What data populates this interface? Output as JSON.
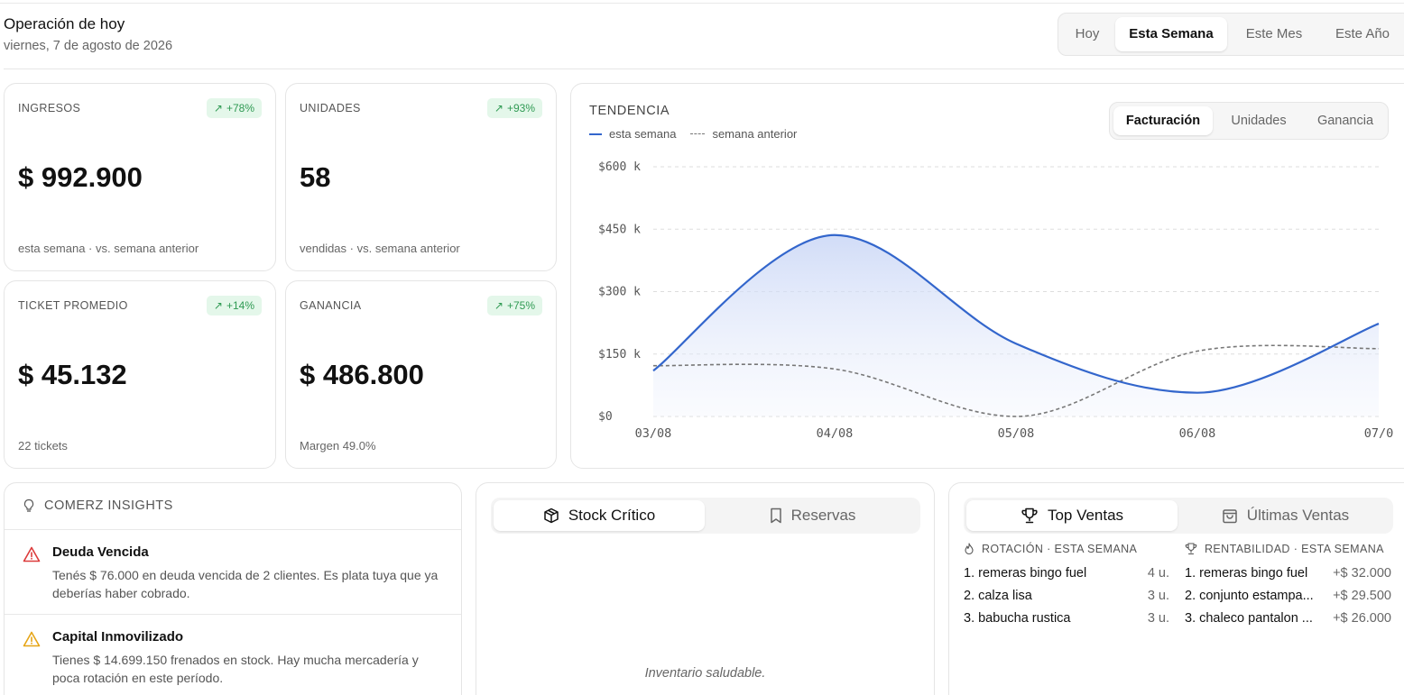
{
  "header": {
    "title": "Operación de hoy",
    "date": "viernes, 7 de agosto de 2026",
    "periods": [
      "Hoy",
      "Esta Semana",
      "Este Mes",
      "Este Año"
    ],
    "active_period": "Esta Semana"
  },
  "kpis": {
    "ingresos": {
      "label": "INGRESOS",
      "badge": "+78%",
      "value": "$ 992.900",
      "sub": "esta semana · vs. semana anterior"
    },
    "unidades": {
      "label": "UNIDADES",
      "badge": "+93%",
      "value": "58",
      "sub": "vendidas · vs. semana anterior"
    },
    "ticket": {
      "label": "TICKET PROMEDIO",
      "badge": "+14%",
      "value": "$ 45.132",
      "sub": "22 tickets"
    },
    "ganancia": {
      "label": "GANANCIA",
      "badge": "+75%",
      "value": "$ 486.800",
      "sub": "Margen 49.0%"
    }
  },
  "trend": {
    "title": "TENDENCIA",
    "legend_current": "esta semana",
    "legend_previous": "semana anterior",
    "tabs": [
      "Facturación",
      "Unidades",
      "Ganancia"
    ],
    "active_tab": "Facturación",
    "colors": {
      "current": "#3366cc",
      "previous": "#777777",
      "fill": "#dfe7fb"
    }
  },
  "chart_data": {
    "type": "area",
    "title": "",
    "xlabel": "",
    "ylabel": "",
    "x": [
      "03/08",
      "04/08",
      "05/08",
      "06/08",
      "07/0"
    ],
    "ylim": [
      0,
      600
    ],
    "y_ticks": [
      "$600 k",
      "$450 k",
      "$300 k",
      "$150 k",
      "$0"
    ],
    "grid": true,
    "series": [
      {
        "name": "esta semana",
        "values": [
          110,
          436,
          175,
          57,
          223
        ]
      },
      {
        "name": "semana anterior",
        "values": [
          122,
          114,
          0,
          157,
          163
        ]
      }
    ]
  },
  "insights": {
    "title": "COMERZ INSIGHTS",
    "items": [
      {
        "title": "Deuda Vencida",
        "text": "Tenés $ 76.000 en deuda vencida de 2 clientes. Es plata tuya que ya deberías haber cobrado.",
        "icon": "warning-red-icon"
      },
      {
        "title": "Capital Inmovilizado",
        "text": "Tienes $ 14.699.150 frenados en stock. Hay mucha mercadería y poca rotación en este período.",
        "icon": "warning-yellow-icon"
      }
    ]
  },
  "stock": {
    "tabs": [
      "Stock Crítico",
      "Reservas"
    ],
    "active_tab": "Stock Crítico",
    "empty": "Inventario saludable."
  },
  "top": {
    "tabs": [
      "Top Ventas",
      "Últimas Ventas"
    ],
    "active_tab": "Top Ventas",
    "rotation_title": "ROTACIÓN · ESTA SEMANA",
    "profit_title": "RENTABILIDAD · ESTA SEMANA",
    "rotation": [
      {
        "name": "1. remeras bingo fuel",
        "value": "4 u."
      },
      {
        "name": "2. calza lisa",
        "value": "3 u."
      },
      {
        "name": "3. babucha rustica",
        "value": "3 u."
      }
    ],
    "profit": [
      {
        "name": "1. remeras bingo fuel",
        "value": "+$ 32.000"
      },
      {
        "name": "2. conjunto estampa...",
        "value": "+$ 29.500"
      },
      {
        "name": "3. chaleco pantalon ...",
        "value": "+$ 26.000"
      }
    ]
  }
}
